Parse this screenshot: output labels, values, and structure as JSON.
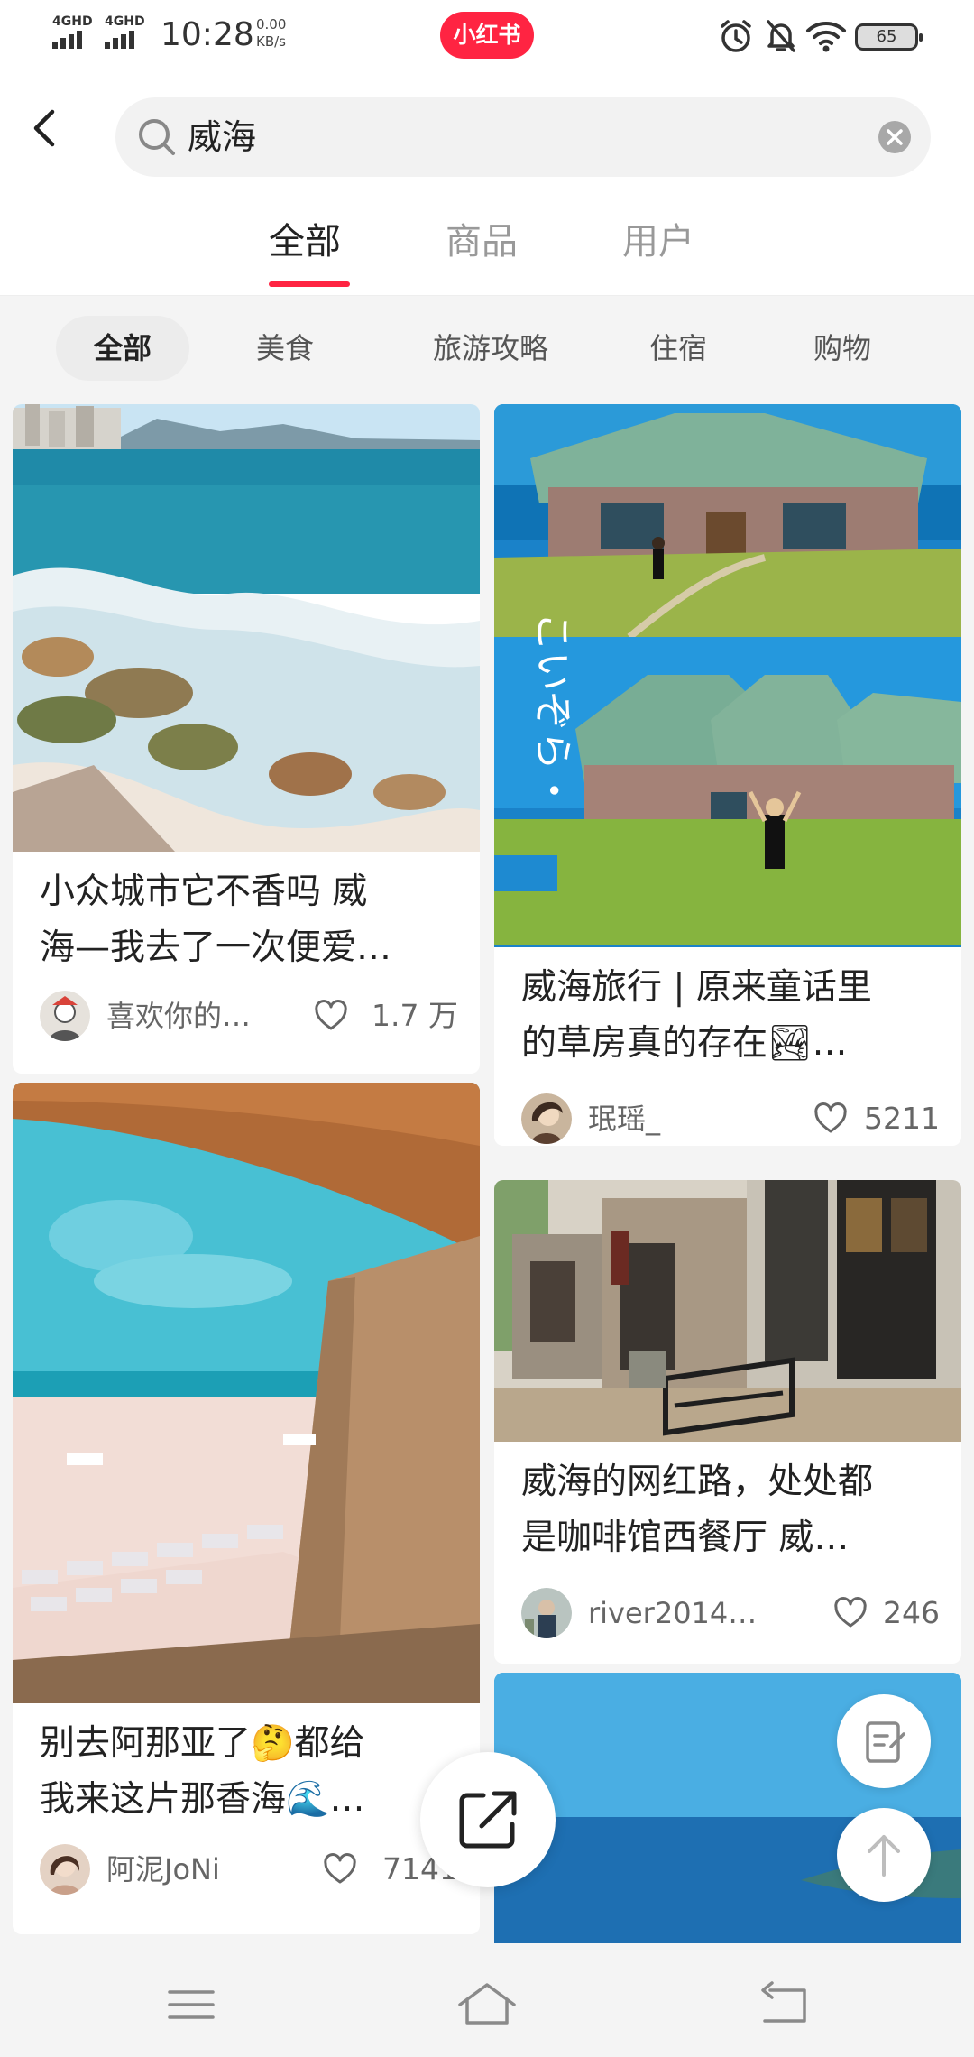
{
  "status_bar": {
    "network_1": "4GHD",
    "network_2": "4GHD",
    "time": "10:28",
    "speed_value": "0.00",
    "speed_unit": "KB/s",
    "app_logo": "小红书",
    "battery": "65"
  },
  "search": {
    "query": "威海"
  },
  "tabs": [
    {
      "label": "全部",
      "active": true
    },
    {
      "label": "商品",
      "active": false
    },
    {
      "label": "用户",
      "active": false
    }
  ],
  "filters": [
    {
      "label": "全部",
      "active": true
    },
    {
      "label": "美食",
      "active": false
    },
    {
      "label": "旅游攻略",
      "active": false
    },
    {
      "label": "住宿",
      "active": false
    },
    {
      "label": "购物",
      "active": false
    }
  ],
  "cards": [
    {
      "title_line1": "小众城市它不香吗 威",
      "title_line2": "海—我去了一次便爱…",
      "author": "喜欢你的…",
      "likes": "1.7 万"
    },
    {
      "title_line1": "威海旅行 | 原来童话里",
      "title_line2": "的草房真的存在🏞…",
      "author": "珉瑶_",
      "likes": "5211"
    },
    {
      "title_line1": "别去阿那亚了🤔都给",
      "title_line2": "我来这片那香海🌊…",
      "author": "阿泥JoNi",
      "likes": "7141"
    },
    {
      "title_line1": "威海的网红路，处处都",
      "title_line2": "是咖啡馆西餐厅 威…",
      "author": "river2014…",
      "likes": "246"
    }
  ],
  "icons": {
    "back": "chevron-left-icon",
    "search": "search-icon",
    "clear": "clear-icon",
    "heart": "heart-icon",
    "edit": "edit-note-icon",
    "top": "arrow-up-icon",
    "share": "share-icon",
    "menu": "menu-icon",
    "home": "home-icon",
    "return": "return-icon"
  },
  "colors": {
    "brand": "#ff2442",
    "text_primary": "#222222",
    "text_secondary": "#666666",
    "page_background": "#f4f4f4"
  }
}
